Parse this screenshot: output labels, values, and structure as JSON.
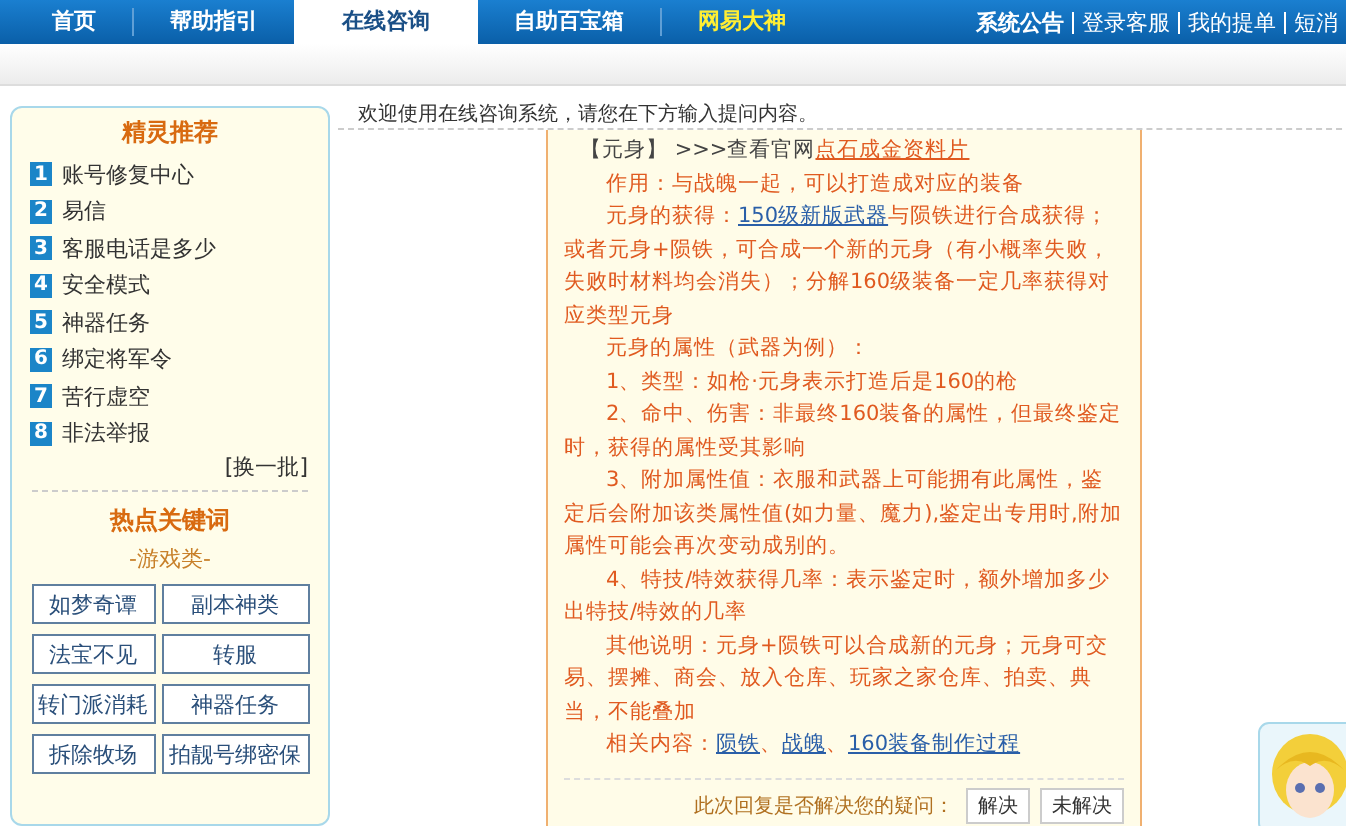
{
  "nav": {
    "tabs": [
      {
        "label": "首页",
        "selected": false,
        "kind": "normal"
      },
      {
        "label": "帮助指引",
        "selected": false,
        "kind": "normal"
      },
      {
        "label": "在线咨询",
        "selected": true,
        "kind": "normal"
      },
      {
        "label": "自助百宝箱",
        "selected": false,
        "kind": "normal"
      },
      {
        "label": "网易大神",
        "selected": false,
        "kind": "highlight"
      }
    ],
    "links": [
      {
        "label": "系统公告",
        "kind": "bold"
      },
      {
        "label": "登录客服",
        "kind": "normal"
      },
      {
        "label": "我的提单",
        "kind": "normal"
      },
      {
        "label": "短消",
        "kind": "normal"
      }
    ]
  },
  "sidebar": {
    "recommend": {
      "title": "精灵推荐",
      "items": [
        {
          "number": "1",
          "label": "账号修复中心"
        },
        {
          "number": "2",
          "label": "易信"
        },
        {
          "number": "3",
          "label": "客服电话是多少"
        },
        {
          "number": "4",
          "label": "安全模式"
        },
        {
          "number": "5",
          "label": "神器任务"
        },
        {
          "number": "6",
          "label": "绑定将军令"
        },
        {
          "number": "7",
          "label": "苦行虚空"
        },
        {
          "number": "8",
          "label": "非法举报"
        }
      ],
      "more": "[换一批]"
    },
    "keywords": {
      "title": "热点关键词",
      "category": "-游戏类-",
      "items": [
        "如梦奇谭",
        "副本神类",
        "法宝不见",
        "转服",
        "转门派消耗",
        "神器任务",
        "拆除牧场",
        "拍靓号绑密保"
      ]
    }
  },
  "chat": {
    "welcome": "欢迎使用在线咨询系统，请您在下方输入提问内容。",
    "paragraphs": [
      {
        "kind": "header",
        "segments": [
          {
            "kind": "text",
            "text": "【元身】 >>>查看官网"
          },
          {
            "kind": "link",
            "text": "点石成金资料片"
          }
        ]
      },
      {
        "kind": "body",
        "segments": [
          {
            "kind": "text",
            "text": "作用：与战魄一起，可以打造成对应的装备"
          }
        ]
      },
      {
        "kind": "body",
        "segments": [
          {
            "kind": "text",
            "text": "元身的获得："
          },
          {
            "kind": "link",
            "text": "150级新版武器"
          },
          {
            "kind": "text",
            "text": "与陨铁进行合成获得；或者元身+陨铁，可合成一个新的元身（有小概率失败，失败时材料均会消失）；分解160级装备一定几率获得对应类型元身"
          }
        ]
      },
      {
        "kind": "body",
        "segments": [
          {
            "kind": "text",
            "text": "元身的属性（武器为例）："
          }
        ]
      },
      {
        "kind": "body",
        "segments": [
          {
            "kind": "text",
            "text": "1、类型：如枪·元身表示打造后是160的枪"
          }
        ]
      },
      {
        "kind": "body",
        "segments": [
          {
            "kind": "text",
            "text": "2、命中、伤害：非最终160装备的属性，但最终鉴定时，获得的属性受其影响"
          }
        ]
      },
      {
        "kind": "body",
        "segments": [
          {
            "kind": "text",
            "text": "3、附加属性值：衣服和武器上可能拥有此属性，鉴定后会附加该类属性值(如力量、魔力),鉴定出专用时,附加属性可能会再次变动成别的。"
          }
        ]
      },
      {
        "kind": "body",
        "segments": [
          {
            "kind": "text",
            "text": "4、特技/特效获得几率：表示鉴定时，额外增加多少出特技/特效的几率"
          }
        ]
      },
      {
        "kind": "body",
        "segments": [
          {
            "kind": "text",
            "text": "其他说明：元身+陨铁可以合成新的元身；元身可交易、摆摊、商会、放入仓库、玩家之家仓库、拍卖、典当，不能叠加"
          }
        ]
      },
      {
        "kind": "body",
        "segments": [
          {
            "kind": "text",
            "text": "相关内容："
          },
          {
            "kind": "link",
            "text": "陨铁"
          },
          {
            "kind": "text",
            "text": "、"
          },
          {
            "kind": "link",
            "text": "战魄"
          },
          {
            "kind": "text",
            "text": "、"
          },
          {
            "kind": "link",
            "text": "160装备制作过程"
          }
        ]
      }
    ],
    "feedback": {
      "question": "此次回复是否解决您的疑问：",
      "buttons": [
        "解决",
        "未解决"
      ]
    }
  }
}
